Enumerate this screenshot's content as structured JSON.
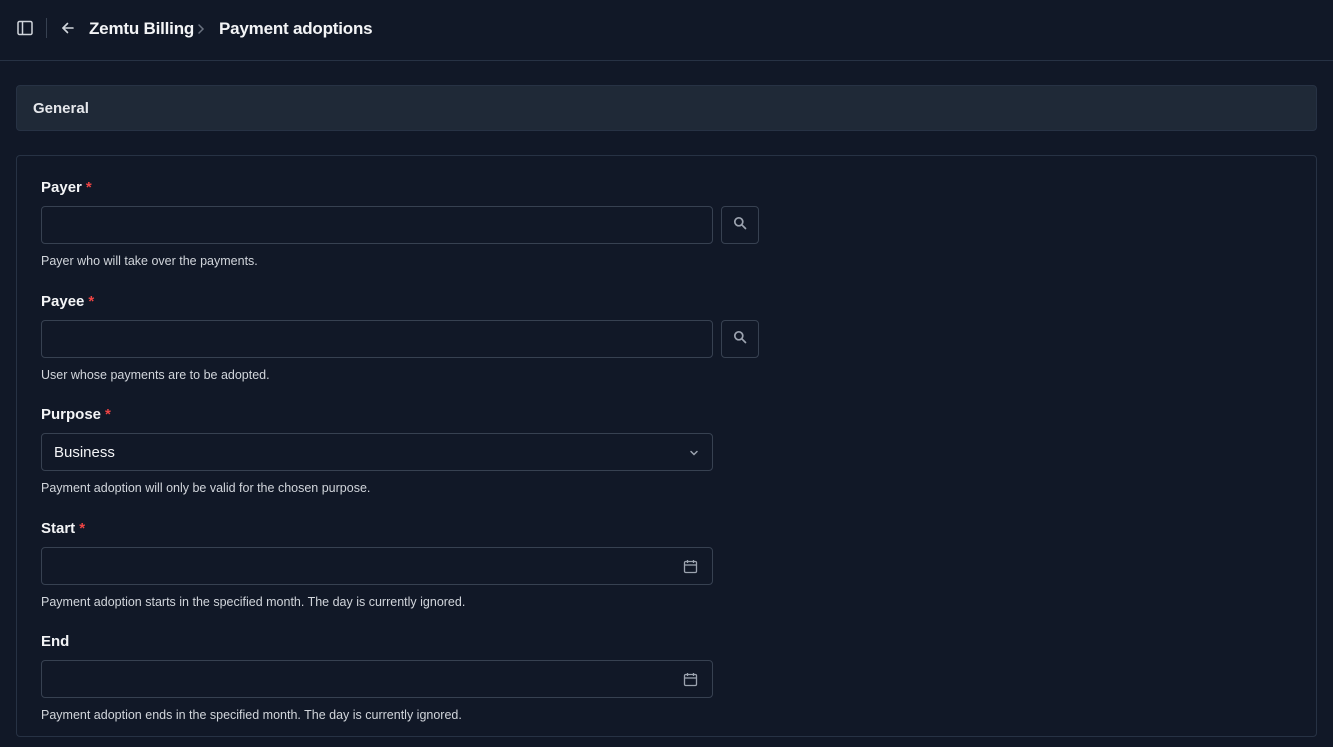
{
  "header": {
    "breadcrumb_root": "Zemtu Billing",
    "breadcrumb_current": "Payment adoptions"
  },
  "section": {
    "title": "General"
  },
  "form": {
    "payer": {
      "label": "Payer",
      "required_mark": "*",
      "value": "",
      "help": "Payer who will take over the payments."
    },
    "payee": {
      "label": "Payee",
      "required_mark": "*",
      "value": "",
      "help": "User whose payments are to be adopted."
    },
    "purpose": {
      "label": "Purpose",
      "required_mark": "*",
      "selected": "Business",
      "help": "Payment adoption will only be valid for the chosen purpose."
    },
    "start": {
      "label": "Start",
      "required_mark": "*",
      "value": "",
      "help": "Payment adoption starts in the specified month. The day is currently ignored."
    },
    "end": {
      "label": "End",
      "value": "",
      "help": "Payment adoption ends in the specified month. The day is currently ignored."
    }
  },
  "icons": {
    "sidebar_toggle": "sidebar-toggle-icon",
    "back": "arrow-left-icon",
    "breadcrumb_separator": "chevron-right-icon",
    "lookup": "search-icon",
    "dropdown": "chevron-down-icon",
    "date": "calendar-icon"
  },
  "colors": {
    "background": "#111827",
    "section_header": "#1f2937",
    "border": "#374151",
    "required": "#ef4444"
  }
}
